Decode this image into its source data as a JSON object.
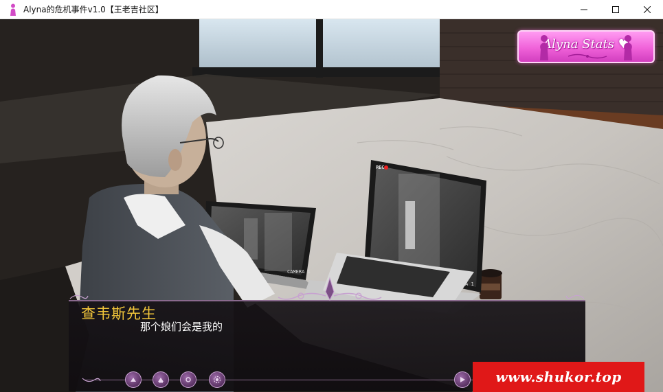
{
  "window": {
    "title": "Alyna的危机事件v1.0【王老吉社区】",
    "icon": "pink-figure-icon",
    "controls": [
      "minimize-icon",
      "maximize-icon",
      "close-icon"
    ]
  },
  "hud": {
    "stats_button_label": "Alyna Stats ♥"
  },
  "scene": {
    "laptop_left_screen_label": "CAMERA 1",
    "laptop_right_screen_label": "CAMERA 1",
    "rec_label": "REC"
  },
  "dialogue": {
    "speaker": "查韦斯先生",
    "text": "那个娘们会是我的",
    "speaker_color": "#f2c63a",
    "controls": [
      "history-icon",
      "save-icon",
      "load-icon",
      "settings-icon",
      "auto-icon",
      "skip-icon",
      "back-icon"
    ]
  },
  "watermark": {
    "text": "www.shukor.top",
    "color": "#e01818"
  }
}
